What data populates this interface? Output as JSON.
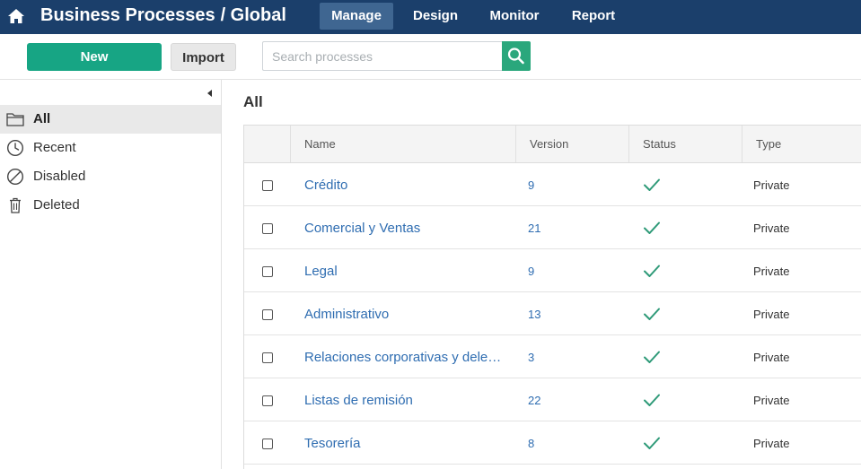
{
  "header": {
    "title": "Business Processes",
    "subtitle": "/ Global",
    "nav": [
      {
        "label": "Manage",
        "active": true
      },
      {
        "label": "Design",
        "active": false
      },
      {
        "label": "Monitor",
        "active": false
      },
      {
        "label": "Report",
        "active": false
      }
    ]
  },
  "toolbar": {
    "new_label": "New",
    "import_label": "Import",
    "search_placeholder": "Search processes",
    "search_value": ""
  },
  "sidebar": {
    "items": [
      {
        "label": "All",
        "icon": "folder-icon",
        "active": true
      },
      {
        "label": "Recent",
        "icon": "clock-icon",
        "active": false
      },
      {
        "label": "Disabled",
        "icon": "disabled-icon",
        "active": false
      },
      {
        "label": "Deleted",
        "icon": "trash-icon",
        "active": false
      }
    ]
  },
  "main": {
    "title": "All",
    "columns": [
      "Name",
      "Version",
      "Status",
      "Type"
    ],
    "rows": [
      {
        "name": "Crédito",
        "version": "9",
        "status": "check-icon",
        "type": "Private"
      },
      {
        "name": "Comercial y Ventas",
        "version": "21",
        "status": "check-icon",
        "type": "Private"
      },
      {
        "name": "Legal",
        "version": "9",
        "status": "check-icon",
        "type": "Private"
      },
      {
        "name": "Administrativo",
        "version": "13",
        "status": "check-icon",
        "type": "Private"
      },
      {
        "name": "Relaciones corporativas y deleg...",
        "version": "3",
        "status": "check-icon",
        "type": "Private"
      },
      {
        "name": "Listas de remisión",
        "version": "22",
        "status": "check-icon",
        "type": "Private"
      },
      {
        "name": "Tesorería",
        "version": "8",
        "status": "check-icon",
        "type": "Private"
      }
    ]
  },
  "colors": {
    "header_bg": "#1b3f6b",
    "active_tab_bg": "#3f6691",
    "primary_button": "#17a584",
    "search_button": "#2aa77c",
    "link": "#2f6db1",
    "check": "#2e9a78"
  }
}
